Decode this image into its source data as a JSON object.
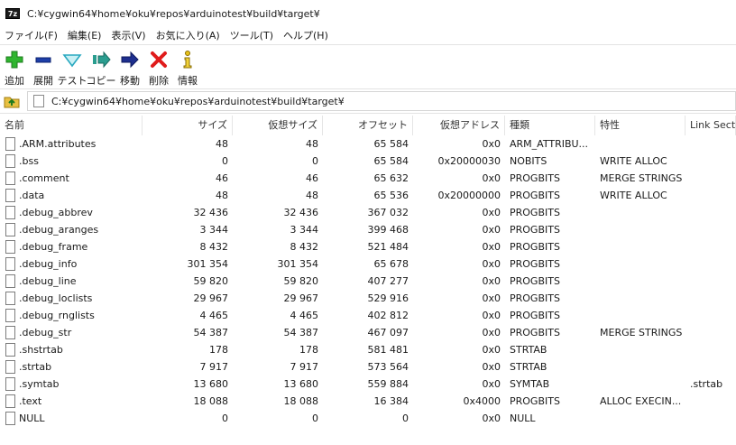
{
  "window": {
    "app_icon_text": "7z",
    "title": "C:¥cygwin64¥home¥oku¥repos¥arduinotest¥build¥target¥"
  },
  "menu": [
    "ファイル(F)",
    "編集(E)",
    "表示(V)",
    "お気に入り(A)",
    "ツール(T)",
    "ヘルプ(H)"
  ],
  "toolbar": {
    "add": "追加",
    "extract": "展開",
    "test": "テスト",
    "copy": "コピー",
    "move": "移動",
    "delete": "削除",
    "info": "情報"
  },
  "address": {
    "path": "C:¥cygwin64¥home¥oku¥repos¥arduinotest¥build¥target¥"
  },
  "columns": {
    "name": "名前",
    "size": "サイズ",
    "vsize": "仮想サイズ",
    "offset": "オフセット",
    "vaddr": "仮想アドレス",
    "type": "種類",
    "char": "特性",
    "link": "Link Section"
  },
  "rows": [
    {
      "name": ".ARM.attributes",
      "size": "48",
      "vsize": "48",
      "offset": "65 584",
      "vaddr": "0x0",
      "type": "ARM_ATTRIBU...",
      "char": "",
      "link": ""
    },
    {
      "name": ".bss",
      "size": "0",
      "vsize": "0",
      "offset": "65 584",
      "vaddr": "0x20000030",
      "type": "NOBITS",
      "char": "WRITE ALLOC",
      "link": ""
    },
    {
      "name": ".comment",
      "size": "46",
      "vsize": "46",
      "offset": "65 632",
      "vaddr": "0x0",
      "type": "PROGBITS",
      "char": "MERGE STRINGS",
      "link": ""
    },
    {
      "name": ".data",
      "size": "48",
      "vsize": "48",
      "offset": "65 536",
      "vaddr": "0x20000000",
      "type": "PROGBITS",
      "char": "WRITE ALLOC",
      "link": ""
    },
    {
      "name": ".debug_abbrev",
      "size": "32 436",
      "vsize": "32 436",
      "offset": "367 032",
      "vaddr": "0x0",
      "type": "PROGBITS",
      "char": "",
      "link": ""
    },
    {
      "name": ".debug_aranges",
      "size": "3 344",
      "vsize": "3 344",
      "offset": "399 468",
      "vaddr": "0x0",
      "type": "PROGBITS",
      "char": "",
      "link": ""
    },
    {
      "name": ".debug_frame",
      "size": "8 432",
      "vsize": "8 432",
      "offset": "521 484",
      "vaddr": "0x0",
      "type": "PROGBITS",
      "char": "",
      "link": ""
    },
    {
      "name": ".debug_info",
      "size": "301 354",
      "vsize": "301 354",
      "offset": "65 678",
      "vaddr": "0x0",
      "type": "PROGBITS",
      "char": "",
      "link": ""
    },
    {
      "name": ".debug_line",
      "size": "59 820",
      "vsize": "59 820",
      "offset": "407 277",
      "vaddr": "0x0",
      "type": "PROGBITS",
      "char": "",
      "link": ""
    },
    {
      "name": ".debug_loclists",
      "size": "29 967",
      "vsize": "29 967",
      "offset": "529 916",
      "vaddr": "0x0",
      "type": "PROGBITS",
      "char": "",
      "link": ""
    },
    {
      "name": ".debug_rnglists",
      "size": "4 465",
      "vsize": "4 465",
      "offset": "402 812",
      "vaddr": "0x0",
      "type": "PROGBITS",
      "char": "",
      "link": ""
    },
    {
      "name": ".debug_str",
      "size": "54 387",
      "vsize": "54 387",
      "offset": "467 097",
      "vaddr": "0x0",
      "type": "PROGBITS",
      "char": "MERGE STRINGS",
      "link": ""
    },
    {
      "name": ".shstrtab",
      "size": "178",
      "vsize": "178",
      "offset": "581 481",
      "vaddr": "0x0",
      "type": "STRTAB",
      "char": "",
      "link": ""
    },
    {
      "name": ".strtab",
      "size": "7 917",
      "vsize": "7 917",
      "offset": "573 564",
      "vaddr": "0x0",
      "type": "STRTAB",
      "char": "",
      "link": ""
    },
    {
      "name": ".symtab",
      "size": "13 680",
      "vsize": "13 680",
      "offset": "559 884",
      "vaddr": "0x0",
      "type": "SYMTAB",
      "char": "",
      "link": ".strtab"
    },
    {
      "name": ".text",
      "size": "18 088",
      "vsize": "18 088",
      "offset": "16 384",
      "vaddr": "0x4000",
      "type": "PROGBITS",
      "char": "ALLOC EXECIN...",
      "link": ""
    },
    {
      "name": "NULL",
      "size": "0",
      "vsize": "0",
      "offset": "0",
      "vaddr": "0x0",
      "type": "NULL",
      "char": "",
      "link": ""
    }
  ]
}
